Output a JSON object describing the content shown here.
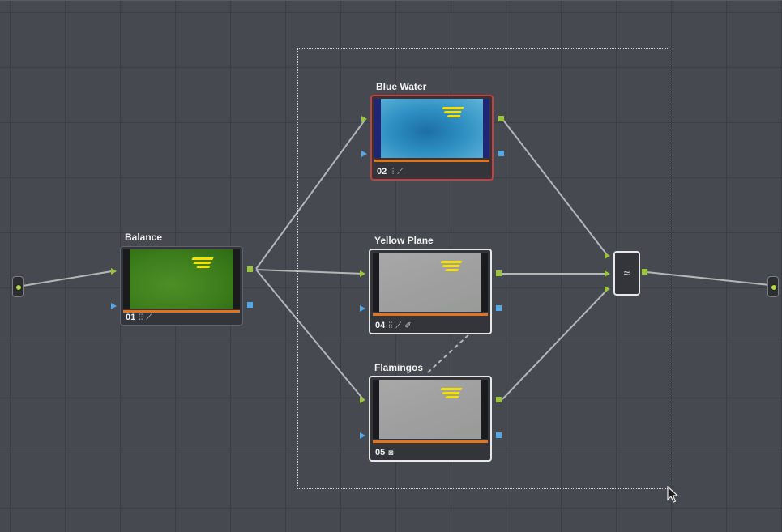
{
  "input_node": {
    "icon": "input-node"
  },
  "output_node": {
    "icon": "output-node"
  },
  "nodes": [
    {
      "id": "balance",
      "title": "Balance",
      "number": "01",
      "thumb": "green",
      "tools": [
        "primaries-icon",
        "curves-icon"
      ]
    },
    {
      "id": "blue-water",
      "title": "Blue Water",
      "number": "02",
      "thumb": "blue",
      "tools": [
        "primaries-icon",
        "curves-icon"
      ]
    },
    {
      "id": "yellow-plane",
      "title": "Yellow Plane",
      "number": "04",
      "thumb": "gray",
      "tools": [
        "primaries-icon",
        "curves-icon",
        "qualifier-icon"
      ]
    },
    {
      "id": "flamingos",
      "title": "Flamingos",
      "number": "05",
      "thumb": "gray",
      "tools": [
        "window-icon"
      ]
    }
  ],
  "mixer": {
    "icon": "layer-mixer-icon",
    "glyph": "≈"
  },
  "colors": {
    "rgb_port": "#9ac63a",
    "key_port": "#53a8e6",
    "active_node_border": "#c8403a",
    "selected_node_border": "#e8e8e8",
    "node_bar": "#e2741e",
    "background": "#474950"
  }
}
